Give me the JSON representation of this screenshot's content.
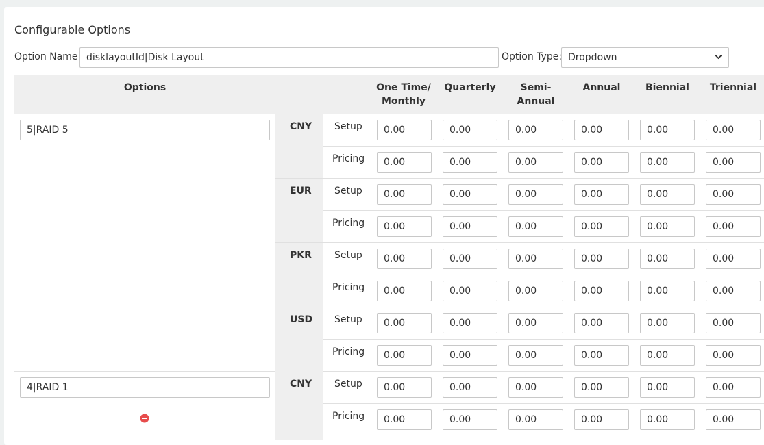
{
  "section_title": "Configurable Options",
  "option_name": {
    "label": "Option Name:",
    "value": "disklayoutId|Disk Layout"
  },
  "option_type": {
    "label": "Option Type:",
    "value": "Dropdown"
  },
  "table": {
    "options_header": "Options",
    "periods": [
      [
        "One Time/",
        "Monthly"
      ],
      [
        "Quarterly"
      ],
      [
        "Semi-",
        "Annual"
      ],
      [
        "Annual"
      ],
      [
        "Biennial"
      ],
      [
        "Triennial"
      ]
    ],
    "price_types": [
      "Setup",
      "Pricing"
    ],
    "currencies": [
      "CNY",
      "EUR",
      "PKR",
      "USD"
    ],
    "default_price": "0.00"
  },
  "options": [
    {
      "name": "5|RAID 5"
    },
    {
      "name": "4|RAID 1"
    }
  ],
  "icons": {
    "remove": "remove-circle-icon"
  },
  "colors": {
    "remove": "#e74c4c"
  }
}
